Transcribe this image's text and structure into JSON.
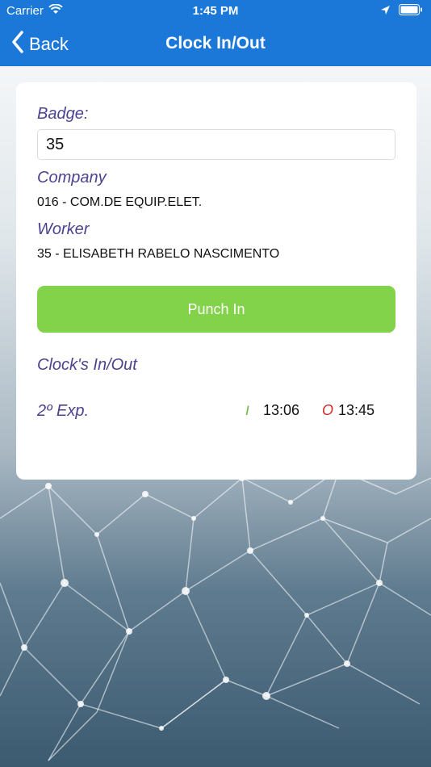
{
  "status_bar": {
    "carrier": "Carrier",
    "time": "1:45 PM"
  },
  "nav": {
    "back_label": "Back",
    "title": "Clock In/Out"
  },
  "form": {
    "badge_label": "Badge:",
    "badge_value": "35",
    "company_label": "Company",
    "company_value": "016 -  COM.DE EQUIP.ELET.",
    "worker_label": "Worker",
    "worker_value": "35 - ELISABETH RABELO NASCIMENTO",
    "punch_button": "Punch In"
  },
  "clocks": {
    "section_title": "Clock's In/Out",
    "entries": [
      {
        "name": "2º Exp.",
        "in_marker": "I",
        "in_time": "13:06",
        "out_marker": "O",
        "out_time": "13:45"
      }
    ]
  },
  "colors": {
    "nav_bg": "#1b78d8",
    "label": "#4b4391",
    "punch_button": "#82d24a",
    "in_marker": "#6ab837",
    "out_marker": "#d42a2a"
  },
  "icons": {
    "wifi": "wifi-icon",
    "location": "location-arrow-icon",
    "battery": "battery-icon",
    "back": "chevron-left-icon"
  }
}
